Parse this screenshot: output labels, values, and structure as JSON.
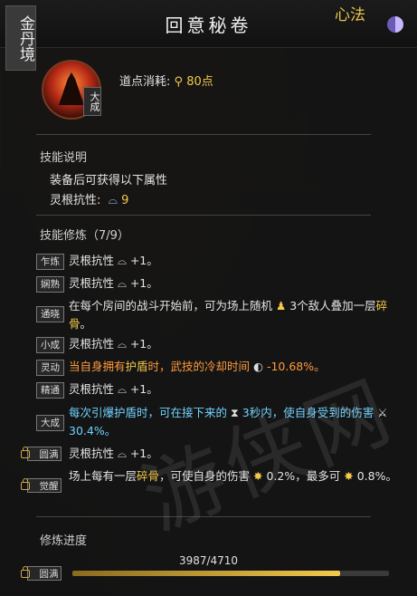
{
  "header": {
    "rank_tag": "金丹境",
    "title": "回意秘卷",
    "xinfa_label": "心法"
  },
  "skill": {
    "avatar_icon": "warrior-silhouette-icon",
    "rank_label": "大成",
    "cost_label": "道点消耗:",
    "cost_value": "80点"
  },
  "description": {
    "heading": "技能说明",
    "line1": "装备后可获得以下属性",
    "attr_label": "灵根抗性:",
    "attr_value": "9"
  },
  "training": {
    "heading": "技能修炼（7/9）",
    "rows": [
      {
        "badge": "乍炼",
        "locked": false,
        "text": "灵根抗性 ⌓ +1。"
      },
      {
        "badge": "娴熟",
        "locked": false,
        "text": "灵根抗性 ⌓ +1。"
      },
      {
        "badge": "通晓",
        "locked": false,
        "text_a": "在每个房间的战斗开始前，可为场上随机",
        "text_b": "3个敌人叠加一层",
        "hl": "碎骨",
        "text_c": "。"
      },
      {
        "badge": "小成",
        "locked": false,
        "text": "灵根抗性 ⌓ +1。"
      },
      {
        "badge": "灵动",
        "locked": false,
        "text_a": "当自身拥有",
        "hl": "护盾",
        "text_b": "时，武技的冷却时间",
        "value": "-10.68%。"
      },
      {
        "badge": "精通",
        "locked": false,
        "text": "灵根抗性 ⌓ +1。"
      },
      {
        "badge": "大成",
        "locked": false,
        "text_a": "每次引爆护盾时，可在接下来的",
        "text_b": "3秒内，使自身受到的伤害",
        "value": "30.4%。"
      },
      {
        "badge": "圆满",
        "locked": true,
        "text": "灵根抗性 ⌓ +1。"
      },
      {
        "badge": "觉醒",
        "locked": true,
        "text_a": "场上每有一层",
        "hl": "碎骨",
        "text_b": "，可使自身的伤害",
        "value_a": "0.2%，最多可",
        "value_b": "0.8%。"
      }
    ]
  },
  "progress": {
    "heading": "修炼进度",
    "value_text": "3987/4710",
    "fraction": 0.8465,
    "next_badge": "圆满"
  },
  "watermark": "游侠网"
}
